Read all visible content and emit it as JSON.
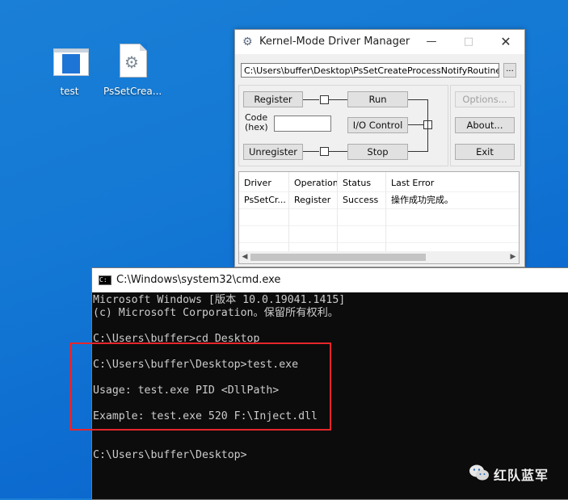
{
  "desktop": {
    "icons": [
      {
        "label": "test"
      },
      {
        "label": "PsSetCrea..."
      }
    ]
  },
  "driver_manager": {
    "title": "Kernel-Mode Driver Manager",
    "path": "C:\\Users\\buffer\\Desktop\\PsSetCreateProcessNotifyRoutineEx.sys",
    "browse_label": "...",
    "buttons": {
      "register": "Register",
      "run": "Run",
      "io_control": "I/O Control",
      "unregister": "Unregister",
      "stop": "Stop",
      "options": "Options...",
      "about": "About...",
      "exit": "Exit"
    },
    "code_label_line1": "Code",
    "code_label_line2": "(hex)",
    "code_value": "",
    "list": {
      "columns": [
        "Driver",
        "Operation",
        "Status",
        "Last Error"
      ],
      "rows": [
        [
          "PsSetCr...",
          "Register",
          "Success",
          "操作成功完成。"
        ]
      ]
    }
  },
  "cmd": {
    "title": "C:\\Windows\\system32\\cmd.exe",
    "lines": [
      "Microsoft Windows [版本 10.0.19041.1415]",
      "(c) Microsoft Corporation。保留所有权利。",
      "",
      "C:\\Users\\buffer>cd Desktop",
      "",
      "C:\\Users\\buffer\\Desktop>test.exe",
      "",
      "Usage: test.exe PID <DllPath>",
      "",
      "Example: test.exe 520 F:\\Inject.dll",
      "",
      "",
      "C:\\Users\\buffer\\Desktop>"
    ]
  },
  "watermark": {
    "text": "红队蓝军"
  },
  "colors": {
    "desktop_blue": "#1479d4",
    "highlight_red": "#e5262c",
    "console_bg": "#0c0c0c",
    "console_text": "#cccccc"
  }
}
